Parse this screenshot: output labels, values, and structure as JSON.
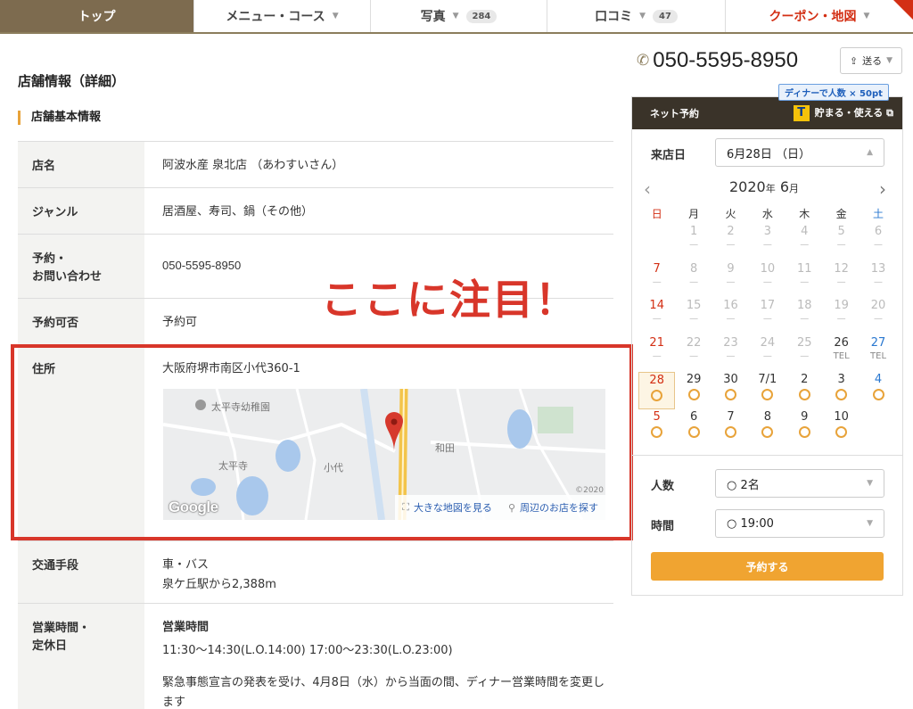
{
  "tabs": [
    {
      "label": "トップ"
    },
    {
      "label": "メニュー・コース"
    },
    {
      "label": "写真",
      "count": "284"
    },
    {
      "label": "口コミ",
      "count": "47"
    },
    {
      "label": "クーポン・地図"
    }
  ],
  "section_title": "店舗情報（詳細）",
  "sub_title": "店舗基本情報",
  "info": {
    "name_label": "店名",
    "name_value": "阿波水産 泉北店 （あわすいさん）",
    "genre_label": "ジャンル",
    "genre_value": "居酒屋、寿司、鍋（その他）",
    "contact_label_1": "予約・",
    "contact_label_2": "お問い合わせ",
    "contact_value": "050-5595-8950",
    "reservable_label": "予約可否",
    "reservable_value": "予約可",
    "address_label": "住所",
    "address_value": "大阪府堺市南区小代360-1",
    "transport_label": "交通手段",
    "transport_line1": "車・バス",
    "transport_line2": "泉ケ丘駅から2,388m",
    "hours_label_1": "営業時間・",
    "hours_label_2": "定休日",
    "hours_head": "営業時間",
    "hours_line": "11:30〜14:30(L.O.14:00) 17:00〜23:30(L.O.23:00)",
    "hours_note": "緊急事態宣言の発表を受け、4月8日（水）から当面の間、ディナー営業時間を変更します"
  },
  "map": {
    "labels": [
      "太平寺幼稚園",
      "太平寺",
      "小代",
      "和田"
    ],
    "google_logo": "Google",
    "copyright": "©2020",
    "link_large": "大きな地図を見る",
    "link_nearby": "周辺のお店を探す"
  },
  "callout": "ここに注目！",
  "sidebar": {
    "phone": "050-5595-8950",
    "send_label": "送る",
    "tpoint_badge": "ディナーで人数 × 50pt",
    "net_reserve": "ネット予約",
    "tpoint_text": "貯まる・使える",
    "visit_label": "来店日",
    "visit_month_day": "6月28日",
    "visit_weekday": "（日）",
    "cal_year": "2020",
    "cal_year_unit": "年",
    "cal_month": "6",
    "cal_month_unit": "月",
    "weekdays": [
      "日",
      "月",
      "火",
      "水",
      "木",
      "金",
      "土"
    ],
    "people_label": "人数",
    "people_value": "○ 2名",
    "time_label": "時間",
    "time_value": "○ 19:00",
    "reserve_button": "予約する"
  },
  "calendar": [
    [
      {
        "d": "",
        "s": ""
      },
      {
        "d": "1",
        "s": "dash"
      },
      {
        "d": "2",
        "s": "dash"
      },
      {
        "d": "3",
        "s": "dash"
      },
      {
        "d": "4",
        "s": "dash"
      },
      {
        "d": "5",
        "s": "dash"
      },
      {
        "d": "6",
        "s": "dash"
      }
    ],
    [
      {
        "d": "7",
        "s": "dash"
      },
      {
        "d": "8",
        "s": "dash"
      },
      {
        "d": "9",
        "s": "dash"
      },
      {
        "d": "10",
        "s": "dash"
      },
      {
        "d": "11",
        "s": "dash"
      },
      {
        "d": "12",
        "s": "dash"
      },
      {
        "d": "13",
        "s": "dash"
      }
    ],
    [
      {
        "d": "14",
        "s": "dash"
      },
      {
        "d": "15",
        "s": "dash"
      },
      {
        "d": "16",
        "s": "dash"
      },
      {
        "d": "17",
        "s": "dash"
      },
      {
        "d": "18",
        "s": "dash"
      },
      {
        "d": "19",
        "s": "dash"
      },
      {
        "d": "20",
        "s": "dash"
      }
    ],
    [
      {
        "d": "21",
        "s": "dash"
      },
      {
        "d": "22",
        "s": "dash"
      },
      {
        "d": "23",
        "s": "dash"
      },
      {
        "d": "24",
        "s": "dash"
      },
      {
        "d": "25",
        "s": "dash"
      },
      {
        "d": "26",
        "s": "TEL"
      },
      {
        "d": "27",
        "s": "TEL"
      }
    ],
    [
      {
        "d": "28",
        "s": "ok",
        "sel": true
      },
      {
        "d": "29",
        "s": "ok"
      },
      {
        "d": "30",
        "s": "ok"
      },
      {
        "d": "7/1",
        "s": "ok"
      },
      {
        "d": "2",
        "s": "ok"
      },
      {
        "d": "3",
        "s": "ok"
      },
      {
        "d": "4",
        "s": "ok"
      }
    ],
    [
      {
        "d": "5",
        "s": "ok"
      },
      {
        "d": "6",
        "s": "ok"
      },
      {
        "d": "7",
        "s": "ok"
      },
      {
        "d": "8",
        "s": "ok"
      },
      {
        "d": "9",
        "s": "ok"
      },
      {
        "d": "10",
        "s": "ok"
      },
      {
        "d": "",
        "s": ""
      }
    ]
  ],
  "colors": {
    "accent_red": "#d8362a",
    "brand_brown": "#7d6b4f",
    "orange": "#f0a431",
    "saturday_blue": "#2a78d0"
  }
}
